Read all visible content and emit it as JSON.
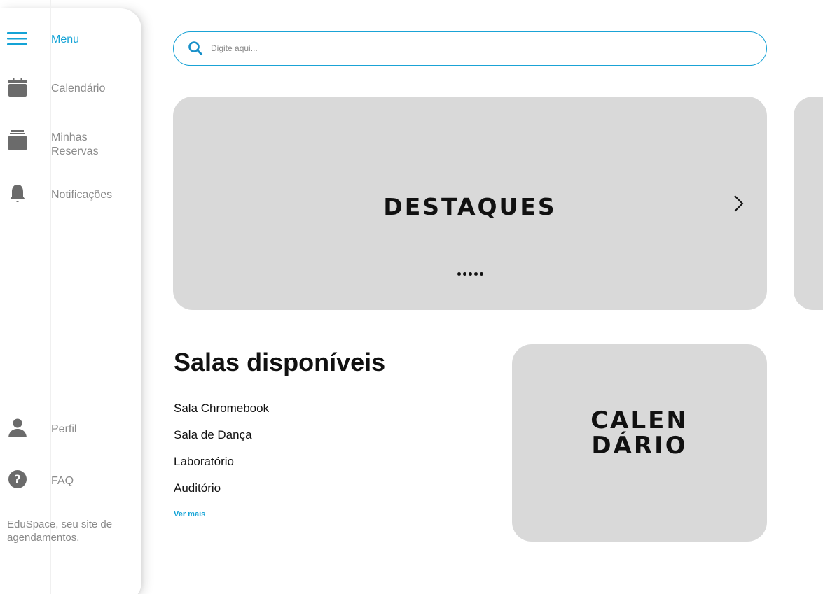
{
  "sidebar": {
    "items": [
      {
        "label": "Menu",
        "icon": "hamburger-icon"
      },
      {
        "label": "Calendário",
        "icon": "calendar-icon"
      },
      {
        "label": "Minhas\nReservas",
        "icon": "reservations-icon"
      },
      {
        "label": "Notificações",
        "icon": "bell-icon"
      }
    ],
    "bottom_items": [
      {
        "label": "Perfil",
        "icon": "user-icon"
      },
      {
        "label": "FAQ",
        "icon": "question-icon"
      }
    ],
    "tagline": "EduSpace, seu site de agendamentos."
  },
  "search": {
    "placeholder": "Digite aqui..."
  },
  "banner": {
    "title": "DESTAQUES",
    "dot_count": 5
  },
  "rooms": {
    "title": "Salas disponíveis",
    "items": [
      "Sala Chromebook",
      "Sala de Dança",
      "Laboratório",
      "Auditório"
    ],
    "see_more": "Ver mais"
  },
  "calendar_card": {
    "line1": "CALEN",
    "line2": "DÁRIO"
  },
  "colors": {
    "accent": "#14a3d6",
    "card": "#d9d9d9",
    "muted_text": "#8a8a8a",
    "icon_gray": "#6b6b6b"
  }
}
